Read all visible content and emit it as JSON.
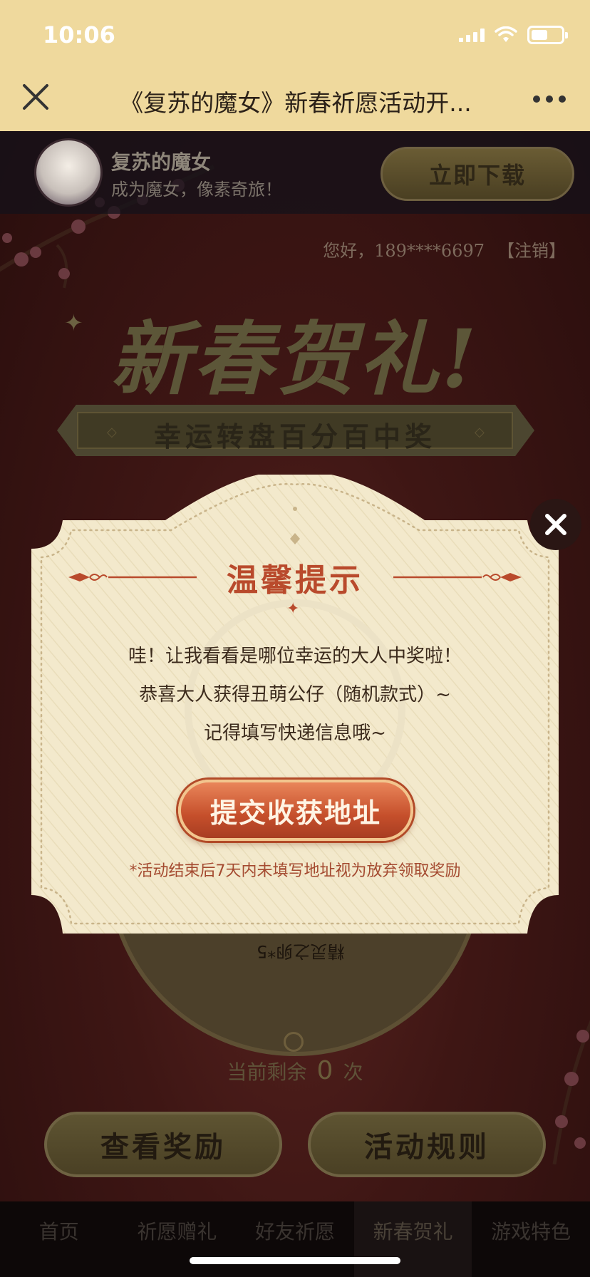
{
  "status_bar": {
    "time": "10:06",
    "battery_percent": 55
  },
  "nav": {
    "title": "《复苏的魔女》新春祈愿活动开..."
  },
  "download_banner": {
    "app_name": "复苏的魔女",
    "slogan": "成为魔女，像素奇旅！",
    "download_label": "立即下载"
  },
  "greeting": {
    "text": "您好，189****6697",
    "logout_label": "【注销】"
  },
  "festival": {
    "title": "新春贺礼!",
    "ribbon": "幸运转盘百分百中奖"
  },
  "wheel": {
    "visible_prize": "精灵之卵*5"
  },
  "remaining": {
    "prefix": "当前剩余",
    "count": "0",
    "suffix": "次"
  },
  "actions": {
    "rewards_label": "查看奖励",
    "rules_label": "活动规则"
  },
  "tabs": [
    {
      "label": "首页"
    },
    {
      "label": "祈愿赠礼"
    },
    {
      "label": "好友祈愿"
    },
    {
      "label": "新春贺礼",
      "active": true
    },
    {
      "label": "游戏特色"
    }
  ],
  "modal": {
    "title": "温馨提示",
    "line1": "哇！让我看看是哪位幸运的大人中奖啦！",
    "line2": "恭喜大人获得丑萌公仔（随机款式）~",
    "line3": "记得填写快递信息哦~",
    "submit_label": "提交收获地址",
    "notice": "*活动结束后7天内未填写地址视为放弃领取奖励"
  },
  "colors": {
    "nav_bg": "#efd99d",
    "modal_bg": "#f2e7c8",
    "accent": "#b94a2c"
  }
}
